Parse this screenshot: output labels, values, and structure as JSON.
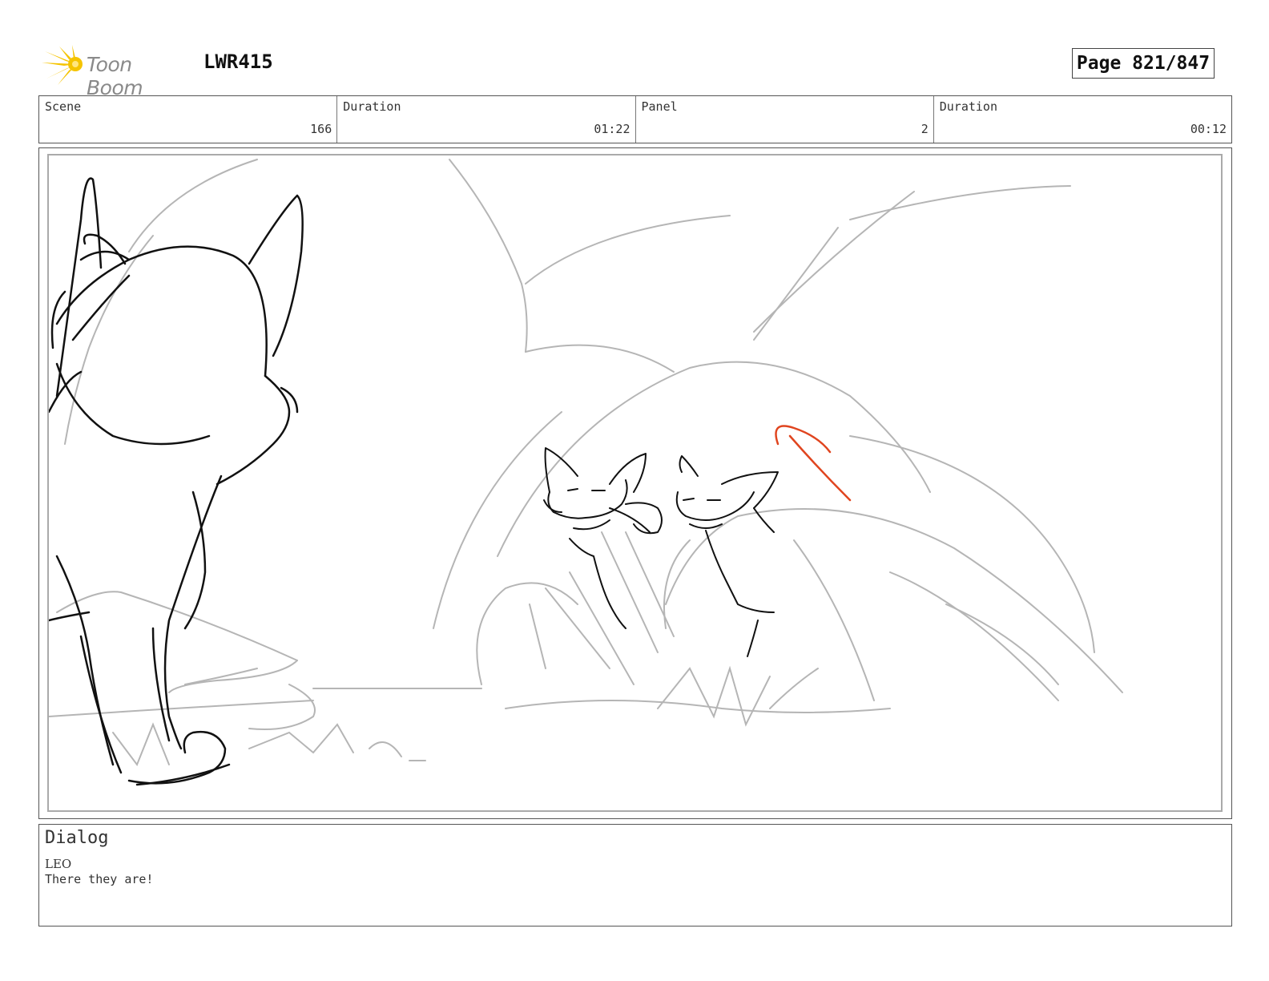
{
  "header": {
    "logo_text": "Toon Boom",
    "project_code": "LWR415",
    "page_label": "Page 821/847"
  },
  "info": {
    "scene_label": "Scene",
    "scene_value": "166",
    "scene_duration_label": "Duration",
    "scene_duration_value": "01:22",
    "panel_label": "Panel",
    "panel_value": "2",
    "panel_duration_label": "Duration",
    "panel_duration_value": "00:12"
  },
  "dialog": {
    "title": "Dialog",
    "speaker": "LEO",
    "line": "There they are!"
  },
  "colors": {
    "logo_yellow": "#f5c400",
    "sketch_dark": "#111111",
    "sketch_light": "#b5b5b5",
    "sketch_accent": "#e0451f"
  },
  "icons": [
    "toon-boom-starburst-icon"
  ]
}
